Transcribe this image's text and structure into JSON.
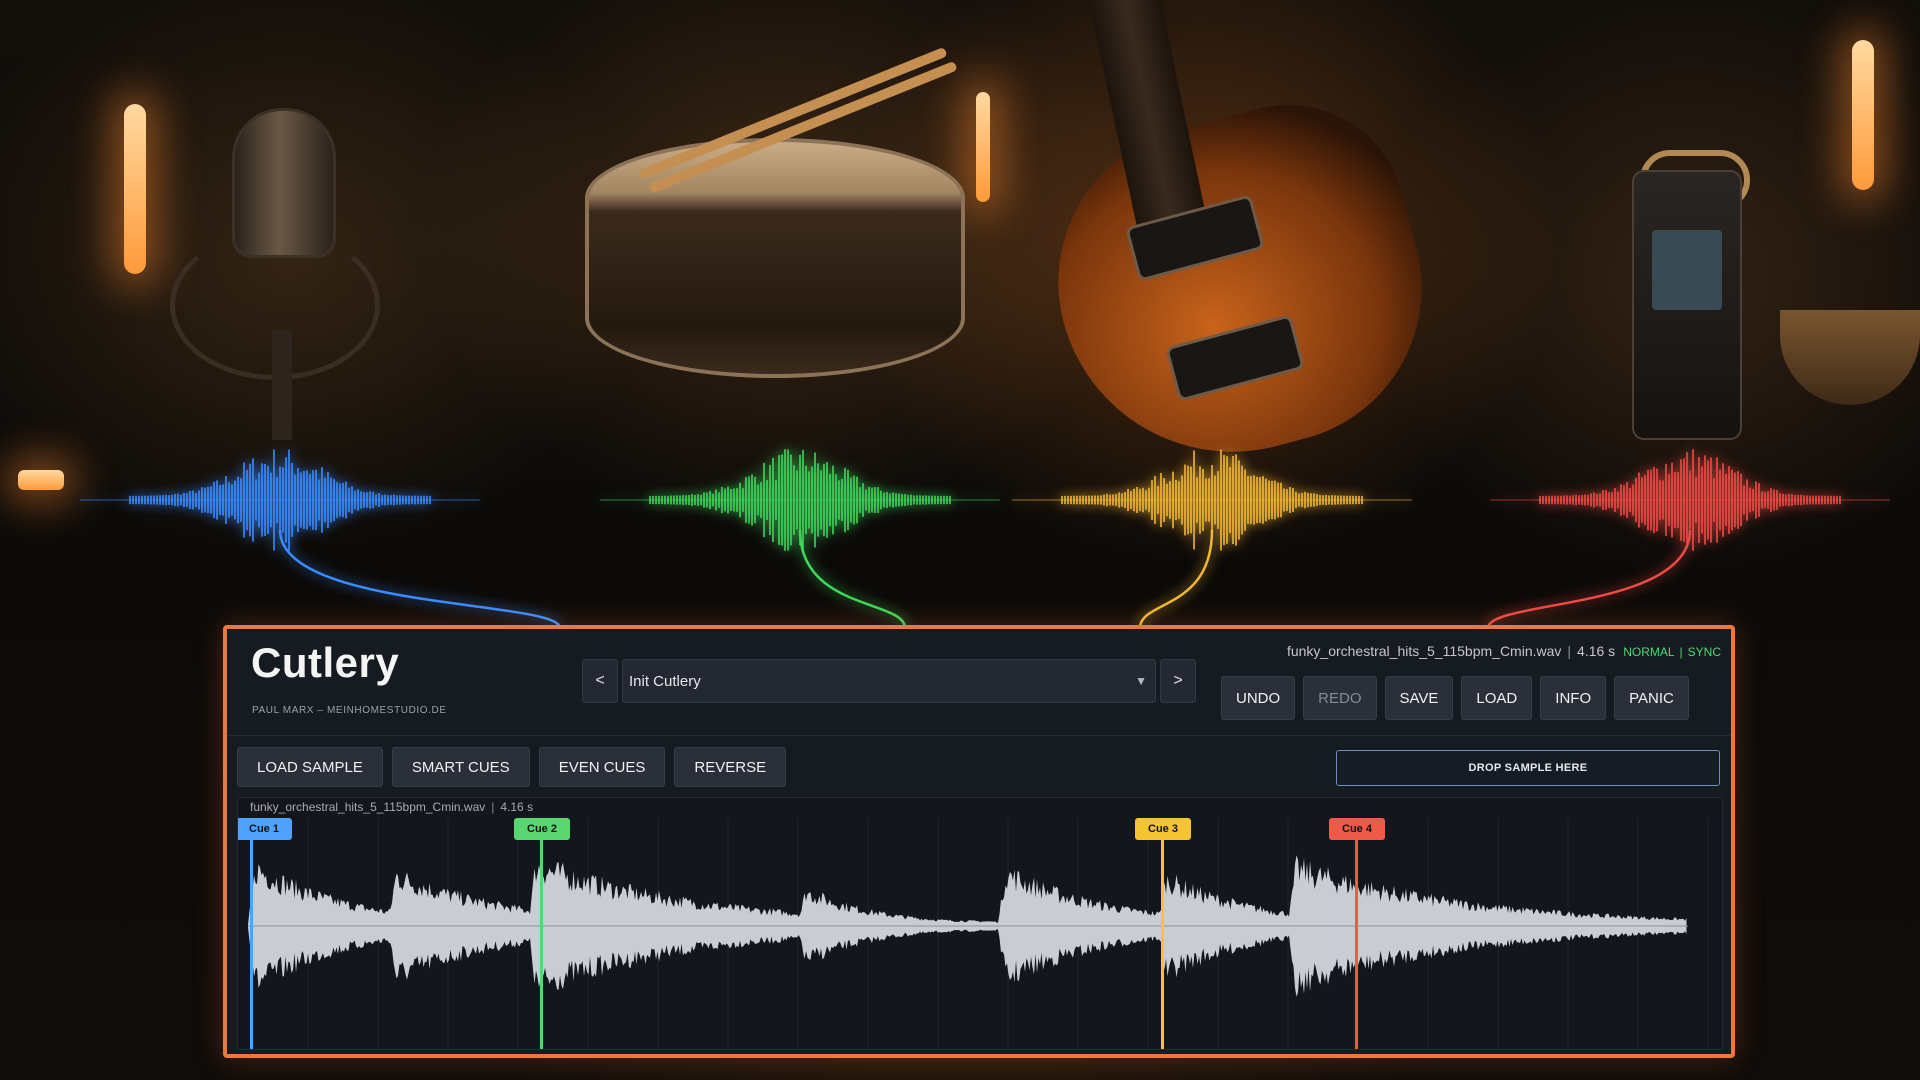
{
  "app": {
    "title": "Cutlery",
    "byline": "PAUL MARX  –  MEINHOMESTUDIO.DE"
  },
  "preset": {
    "prev_label": "<",
    "next_label": ">",
    "current": "Init Cutlery",
    "caret": "▼"
  },
  "file": {
    "name": "funky_orchestral_hits_5_115bpm_Cmin.wav",
    "duration": "4.16 s",
    "sep": "|",
    "mode": "NORMAL",
    "sync": "SYNC"
  },
  "toolbar": {
    "undo": "UNDO",
    "redo": "REDO",
    "save": "SAVE",
    "load": "LOAD",
    "info": "INFO",
    "panic": "PANIC"
  },
  "actions": {
    "load_sample": "LOAD SAMPLE",
    "smart_cues": "SMART CUES",
    "even_cues": "EVEN CUES",
    "reverse": "REVERSE"
  },
  "drop_zone": "DROP SAMPLE HERE",
  "cues": [
    {
      "label": "Cue 1",
      "color": "#4da3ff",
      "position": 0.008
    },
    {
      "label": "Cue 2",
      "color": "#5ad670",
      "position": 0.203
    },
    {
      "label": "Cue 3",
      "color": "#f4c431",
      "position": 0.621
    },
    {
      "label": "Cue 4",
      "color": "#ef5a48",
      "position": 0.752
    }
  ],
  "colors": {
    "accent_border": "#f0773a",
    "panel_bg": "#161a21",
    "wave_fill": "#c9ccd2",
    "mode_green": "#4fd970"
  },
  "background_waves": [
    {
      "color": "#3a8cff"
    },
    {
      "color": "#3fd65c"
    },
    {
      "color": "#f2b733"
    },
    {
      "color": "#ef4b45"
    }
  ]
}
